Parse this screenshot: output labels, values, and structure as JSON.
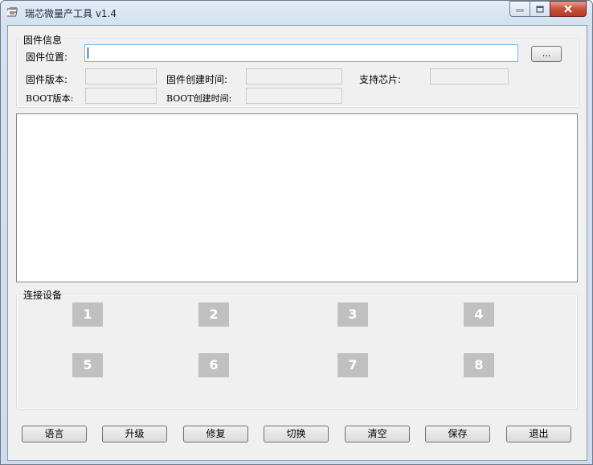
{
  "window": {
    "title": "瑞芯微量产工具 v1.4",
    "app_icon": "usb-tool-icon"
  },
  "firmware_group": {
    "legend": "固件信息",
    "location_label": "固件位置:",
    "location_value": "",
    "browse_label": "...",
    "version_label": "固件版本:",
    "version_value": "",
    "create_time_label": "固件创建时间:",
    "create_time_value": "",
    "chip_label": "支持芯片:",
    "chip_value": "",
    "boot_version_label": "BOOT版本:",
    "boot_version_value": "",
    "boot_time_label": "BOOT创建时间:",
    "boot_time_value": ""
  },
  "log": {
    "text": ""
  },
  "devices_group": {
    "legend": "连接设备",
    "devices": [
      "1",
      "2",
      "3",
      "4",
      "5",
      "6",
      "7",
      "8"
    ],
    "device_color": "#c0c0c0"
  },
  "buttons": {
    "language": "语言",
    "upgrade": "升级",
    "repair": "修复",
    "switch": "切换",
    "clear": "清空",
    "save": "保存",
    "exit": "退出"
  }
}
